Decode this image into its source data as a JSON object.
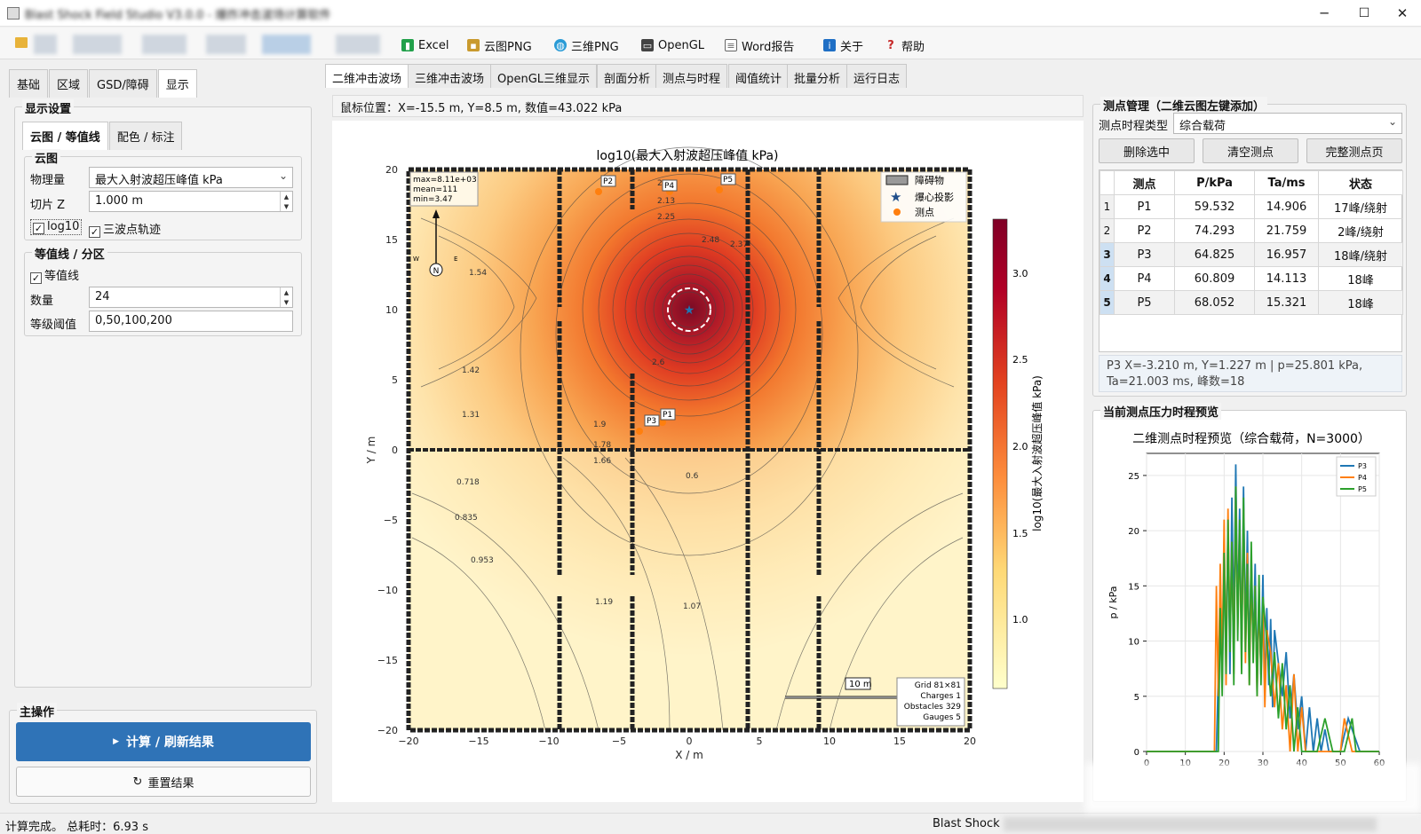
{
  "window": {
    "title": "Blast Shock Field Studio V3.0.0 - 爆炸冲击波场计算软件",
    "minimize": "─",
    "maximize": "☐",
    "close": "✕"
  },
  "toolbar": {
    "excel": "Excel",
    "cloud_png": "云图PNG",
    "three_png": "三维PNG",
    "opengl": "OpenGL",
    "word": "Word报告",
    "about": "关于",
    "help": "帮助"
  },
  "left": {
    "tabs": [
      "基础",
      "区域",
      "GSD/障碍",
      "显示"
    ],
    "display_settings": "显示设置",
    "subtabs": [
      "云图 / 等值线",
      "配色 / 标注"
    ],
    "cloud": {
      "title": "云图",
      "quantity_label": "物理量",
      "quantity_value": "最大入射波超压峰值 kPa",
      "slice_label": "切片 Z",
      "slice_value": "1.000 m",
      "log10": "log10",
      "triple_track": "三波点轨迹"
    },
    "contour": {
      "title": "等值线 / 分区",
      "contour_chk": "等值线",
      "count_label": "数量",
      "count_value": "24",
      "threshold_label": "等级阈值",
      "threshold_value": "0,50,100,200"
    },
    "main_op": "主操作",
    "compute_btn": "计算 / 刷新结果",
    "reset_btn": "重置结果"
  },
  "center": {
    "tabs": [
      "二维冲击波场",
      "三维冲击波场",
      "OpenGL三维显示",
      "剖面分析",
      "测点与时程",
      "阈值统计",
      "批量分析",
      "运行日志"
    ],
    "mouse_pos": "鼠标位置：X=-15.5 m, Y=8.5 m, 数值=43.022 kPa"
  },
  "field_plot": {
    "title": "log10(最大入射波超压峰值 kPa)",
    "xlabel": "X / m",
    "ylabel": "Y / m",
    "xticks": [
      "−20",
      "−15",
      "−10",
      "−5",
      "0",
      "5",
      "10",
      "15",
      "20"
    ],
    "yticks": [
      "20",
      "15",
      "10",
      "5",
      "0",
      "−5",
      "−10",
      "−15",
      "−20"
    ],
    "colorbar_label": "log10(最大入射波超压峰值 kPa)",
    "colorbar_ticks": [
      "3.0",
      "2.5",
      "2.0",
      "1.5",
      "1.0"
    ],
    "stats": [
      "max=8.11e+03",
      "mean=111",
      "min=3.47"
    ],
    "legend": [
      "障碍物",
      "爆心投影",
      "测点"
    ],
    "info": [
      "Grid 81×81",
      "Charges 1",
      "Obstacles 329",
      "Gauges 5"
    ],
    "scale_label": "10 m",
    "compass": [
      "N",
      "W",
      "E"
    ],
    "gauges": [
      "P1",
      "P2",
      "P3",
      "P4",
      "P5"
    ],
    "contour_labels": [
      "2.01",
      "2.13",
      "2.25",
      "2.37",
      "2.48",
      "2.6",
      "1.9",
      "1.78",
      "1.66",
      "1.54",
      "1.42",
      "1.31",
      "1.19",
      "1.07",
      "0.953",
      "0.835",
      "0.718",
      "0.6"
    ]
  },
  "right": {
    "gauge_mgmt": "测点管理（二维云图左键添加）",
    "type_label": "测点时程类型",
    "type_value": "综合载荷",
    "btn_delete": "删除选中",
    "btn_clear": "清空测点",
    "btn_full": "完整测点页",
    "table_headers": [
      "测点",
      "P/kPa",
      "Ta/ms",
      "状态"
    ],
    "rows": [
      {
        "n": "1",
        "name": "P1",
        "p": "59.532",
        "ta": "14.906",
        "status": "17峰/绕射"
      },
      {
        "n": "2",
        "name": "P2",
        "p": "74.293",
        "ta": "21.759",
        "status": "2峰/绕射"
      },
      {
        "n": "3",
        "name": "P3",
        "p": "64.825",
        "ta": "16.957",
        "status": "18峰/绕射"
      },
      {
        "n": "4",
        "name": "P4",
        "p": "60.809",
        "ta": "14.113",
        "status": "18峰"
      },
      {
        "n": "5",
        "name": "P5",
        "p": "68.052",
        "ta": "15.321",
        "status": "18峰"
      }
    ],
    "detail_line1": "P3  X=-3.210 m, Y=1.227 m  |  p=25.801 kPa,",
    "detail_line2": "Ta=21.003 ms, 峰数=18",
    "preview_title": "当前测点压力时程预览"
  },
  "chart_data": {
    "type": "line",
    "title": "二维测点时程预览（综合载荷，N=3000）",
    "xlabel": "",
    "ylabel": "p / kPa",
    "xlim": [
      0,
      60
    ],
    "ylim": [
      0,
      27
    ],
    "xticks": [
      "0",
      "10",
      "20",
      "30",
      "40",
      "50",
      "60"
    ],
    "yticks": [
      "0",
      "5",
      "10",
      "15",
      "20",
      "25"
    ],
    "legend_position": "top-right",
    "series": [
      {
        "name": "P3",
        "color": "#1f77b4",
        "x": [
          0,
          18,
          19,
          19.5,
          20,
          20.5,
          21,
          21.5,
          22,
          22.5,
          23,
          23.5,
          24,
          24.5,
          25,
          25.5,
          26,
          26.5,
          27,
          27.5,
          28,
          28.5,
          29,
          29.5,
          30,
          30.5,
          31,
          31.5,
          32,
          32.5,
          33,
          34,
          35,
          36,
          37,
          38,
          39,
          40,
          41,
          42,
          43,
          44,
          45,
          46,
          47,
          48,
          50,
          52,
          55,
          57,
          60
        ],
        "y": [
          0,
          0,
          14,
          6,
          19,
          9,
          20,
          7,
          23,
          11,
          26,
          12,
          22,
          9,
          24,
          10,
          20,
          8,
          18,
          9,
          17,
          6,
          15,
          7,
          16,
          5,
          13,
          6,
          12,
          4,
          11,
          8,
          5,
          9,
          3,
          7,
          2,
          5,
          0,
          4,
          0,
          3,
          0,
          2,
          0,
          0,
          0,
          3,
          0,
          0,
          0
        ]
      },
      {
        "name": "P4",
        "color": "#ff7f0e",
        "x": [
          0,
          17.5,
          18,
          18.5,
          19,
          19.5,
          20,
          20.5,
          21,
          21.5,
          22,
          22.5,
          23,
          23.5,
          24,
          24.5,
          25,
          25.5,
          26,
          26.5,
          27,
          27.5,
          28,
          28.5,
          29,
          29.5,
          30,
          30.5,
          31,
          32,
          33,
          34,
          35,
          36,
          37,
          38,
          39,
          40,
          41,
          42,
          50,
          51,
          53,
          55,
          60
        ],
        "y": [
          0,
          0,
          15,
          5,
          17,
          8,
          21,
          6,
          22,
          10,
          19,
          7,
          24,
          11,
          20,
          9,
          22,
          8,
          18,
          6,
          16,
          9,
          15,
          5,
          14,
          7,
          13,
          4,
          11,
          9,
          4,
          8,
          2,
          6,
          0,
          7,
          0,
          4,
          0,
          0,
          0,
          3,
          0,
          0,
          0
        ]
      },
      {
        "name": "P5",
        "color": "#2ca02c",
        "x": [
          0,
          18.5,
          19,
          19.5,
          20,
          20.5,
          21,
          21.5,
          22,
          22.5,
          23,
          23.5,
          24,
          24.5,
          25,
          25.5,
          26,
          26.5,
          27,
          27.5,
          28,
          28.5,
          29,
          29.5,
          30,
          31,
          32,
          33,
          34,
          35,
          36,
          37,
          38,
          39,
          40,
          44,
          46,
          48,
          51,
          53,
          54,
          56,
          60
        ],
        "y": [
          0,
          0,
          13,
          5,
          18,
          7,
          21,
          9,
          19,
          6,
          24,
          10,
          21,
          7,
          23,
          9,
          17,
          6,
          19,
          8,
          15,
          5,
          16,
          6,
          14,
          10,
          5,
          9,
          3,
          8,
          2,
          6,
          0,
          4,
          0,
          0,
          3,
          0,
          0,
          3,
          0,
          0,
          0
        ]
      }
    ]
  }
}
